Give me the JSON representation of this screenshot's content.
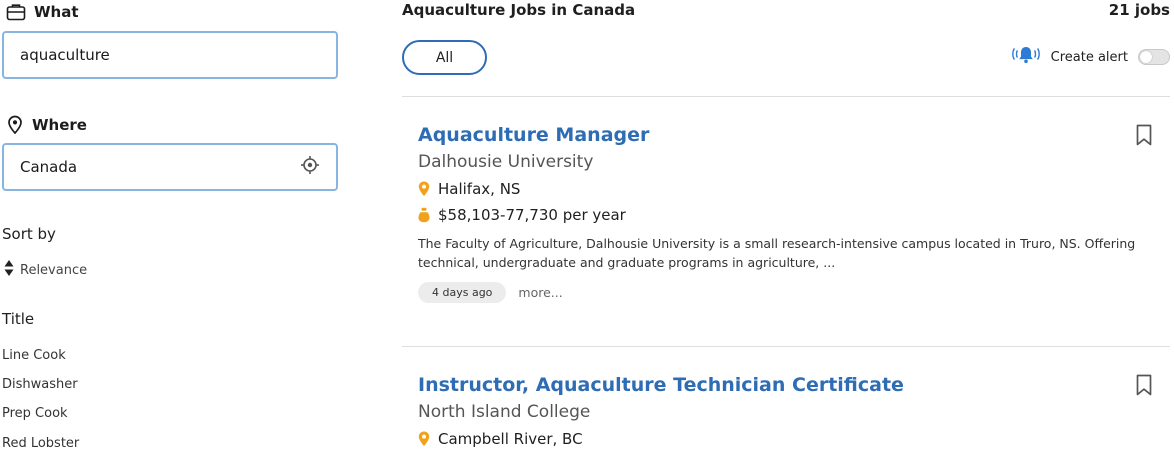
{
  "search": {
    "what_label": "What",
    "what_value": "aquaculture",
    "where_label": "Where",
    "where_value": "Canada"
  },
  "sort": {
    "title": "Sort by",
    "selected": "Relevance"
  },
  "title_filter": {
    "title": "Title",
    "items": [
      "Line Cook",
      "Dishwasher",
      "Prep Cook",
      "Red Lobster"
    ]
  },
  "results": {
    "heading": "Aquaculture Jobs in Canada",
    "count": "21 jobs",
    "chip_all": "All",
    "create_alert": "Create alert"
  },
  "jobs": [
    {
      "title": "Aquaculture Manager",
      "company": "Dalhousie University",
      "location": "Halifax, NS",
      "salary": "$58,103-77,730 per year",
      "snippet": "The Faculty of Agriculture, Dalhousie University is a small research-intensive campus located in Truro, NS. Offering technical, undergraduate and graduate programs in agriculture, ...",
      "age": "4 days ago",
      "more": "more..."
    },
    {
      "title": "Instructor, Aquaculture Technician Certificate",
      "company": "North Island College",
      "location": "Campbell River, BC"
    }
  ],
  "colors": {
    "accent": "#2e6db4",
    "input_border": "#8ab4e0",
    "pin": "#f0a21c",
    "bell": "#2e7bd6"
  }
}
